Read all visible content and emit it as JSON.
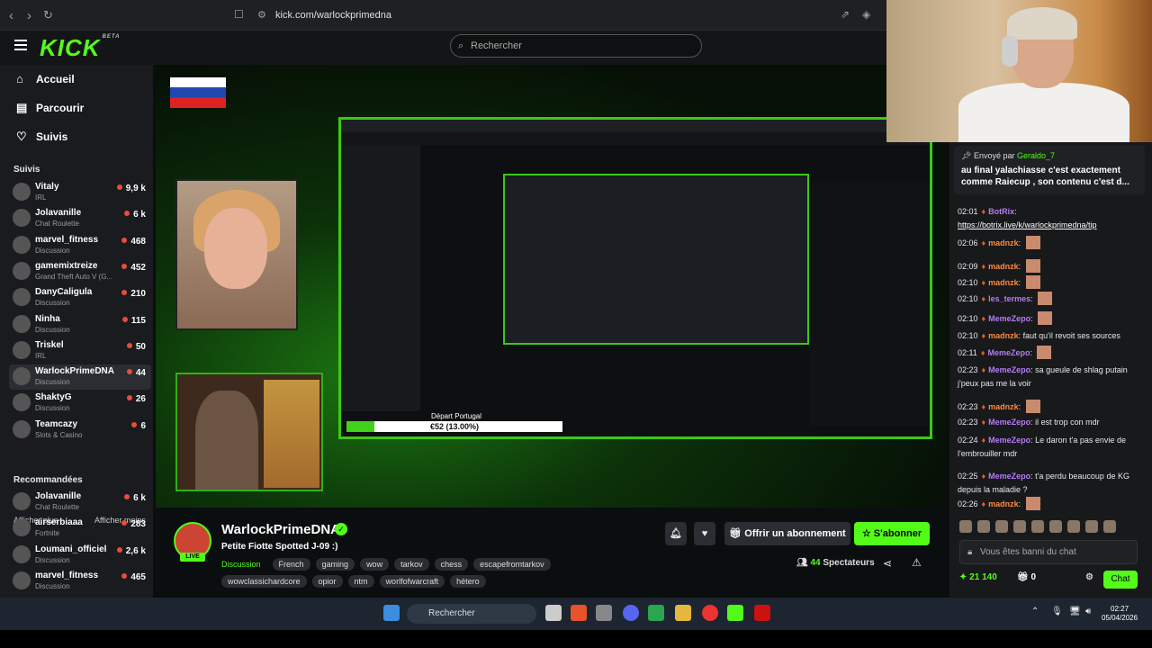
{
  "browser": {
    "url": "kick.com/warlockprimedna"
  },
  "header": {
    "logo": "KICK",
    "logo_sup": "BETA",
    "search_placeholder": "Rechercher"
  },
  "sidebar": {
    "nav": [
      {
        "label": "Accueil",
        "icon": "home-icon"
      },
      {
        "label": "Parcourir",
        "icon": "browse-icon"
      },
      {
        "label": "Suivis",
        "icon": "heart-icon"
      }
    ],
    "following_title": "Suivis",
    "following": [
      {
        "name": "Vitaly",
        "category": "IRL",
        "viewers": "9,9 k"
      },
      {
        "name": "Jolavanille",
        "category": "Chat Roulette",
        "viewers": "6 k"
      },
      {
        "name": "marvel_fitness",
        "category": "Discussion",
        "viewers": "468"
      },
      {
        "name": "gamemixtreize",
        "category": "Grand Theft Auto V (G...",
        "viewers": "452"
      },
      {
        "name": "DanyCaligula",
        "category": "Discussion",
        "viewers": "210"
      },
      {
        "name": "Ninha",
        "category": "Discussion",
        "viewers": "115"
      },
      {
        "name": "Triskel",
        "category": "IRL",
        "viewers": "50"
      },
      {
        "name": "WarlockPrimeDNA",
        "category": "Discussion",
        "viewers": "44"
      },
      {
        "name": "ShaktyG",
        "category": "Discussion",
        "viewers": "26"
      },
      {
        "name": "Teamcazy",
        "category": "Slots & Casino",
        "viewers": "6"
      }
    ],
    "show_more": "Afficher plus",
    "show_less": "Afficher moins",
    "recommended_title": "Recommandées",
    "recommended": [
      {
        "name": "Jolavanille",
        "category": "Chat Roulette",
        "viewers": "6 k"
      },
      {
        "name": "airserbiaaa",
        "category": "Fortnite",
        "viewers": "283"
      },
      {
        "name": "Loumani_officiel",
        "category": "Discussion",
        "viewers": "2,6 k"
      },
      {
        "name": "marvel_fitness",
        "category": "Discussion",
        "viewers": "465"
      }
    ]
  },
  "video": {
    "depart": "Départ Portugal",
    "goal_text": "€52 (13.00%)",
    "goal_progress": 0.13
  },
  "stream": {
    "name": "WarlockPrimeDNA",
    "title": "Petite Fiotte Spotted J-09 :)",
    "category": "Discussion",
    "tags": [
      "French",
      "gaming",
      "wow",
      "tarkov",
      "chess",
      "escapefromtarkov",
      "wowclassichardcore",
      "opior",
      "ntm",
      "worlfofwarcraft",
      "hétero"
    ],
    "live": "LIVE",
    "subscribe_gift": "Offrir un abonnement",
    "subscribe": "S'abonner",
    "viewers": "44",
    "viewers_label": "Spectateurs"
  },
  "chat": {
    "pinned_by_label": "Envoyé par",
    "pinned_by": "Geraldo_7",
    "pinned_msg": "au final yalachiasse c'est exactement comme Raiecup , son contenu c'est d...",
    "messages": [
      {
        "time": "02:01",
        "user": "BotRix",
        "text": "https://botrix.live/k/warlockprimedna/tip",
        "color": "purple"
      },
      {
        "time": "02:06",
        "user": "madnzk",
        "text": "",
        "emote": true
      },
      {
        "time": "02:09",
        "user": "madnzk",
        "text": "",
        "emote": true
      },
      {
        "time": "02:10",
        "user": "madnzk",
        "text": "",
        "emote": true
      },
      {
        "time": "02:10",
        "user": "les_termes",
        "text": "",
        "emote": true,
        "color": "purple"
      },
      {
        "time": "02:10",
        "user": "MemeZepo",
        "text": "",
        "emote": true,
        "color": "purple"
      },
      {
        "time": "02:10",
        "user": "madnzk",
        "text": "faut qu'il revoit ses sources"
      },
      {
        "time": "02:11",
        "user": "MemeZepo",
        "text": "",
        "emote": true,
        "color": "purple"
      },
      {
        "time": "02:23",
        "user": "MemeZepo",
        "text": "sa gueule de shlag putain j'peux pas me la voir",
        "color": "purple"
      },
      {
        "time": "02:23",
        "user": "madnzk",
        "text": "",
        "emote": true
      },
      {
        "time": "02:23",
        "user": "MemeZepo",
        "text": "il est trop con mdr",
        "color": "purple"
      },
      {
        "time": "02:24",
        "user": "MemeZepo",
        "text": "Le daron t'a pas envie de l'embrouiller mdr",
        "color": "purple"
      },
      {
        "time": "02:25",
        "user": "MemeZepo",
        "text": "t'a perdu beaucoup de KG depuis la maladie ?",
        "color": "purple"
      },
      {
        "time": "02:26",
        "user": "madnzk",
        "text": "",
        "emote": true
      }
    ],
    "input_placeholder": "Vous êtes banni du chat",
    "points": "21 140",
    "gifts": "0",
    "chat_button": "Chat"
  },
  "taskbar": {
    "search": "Rechercher",
    "time": "02:27",
    "date": "05/04/2026"
  }
}
